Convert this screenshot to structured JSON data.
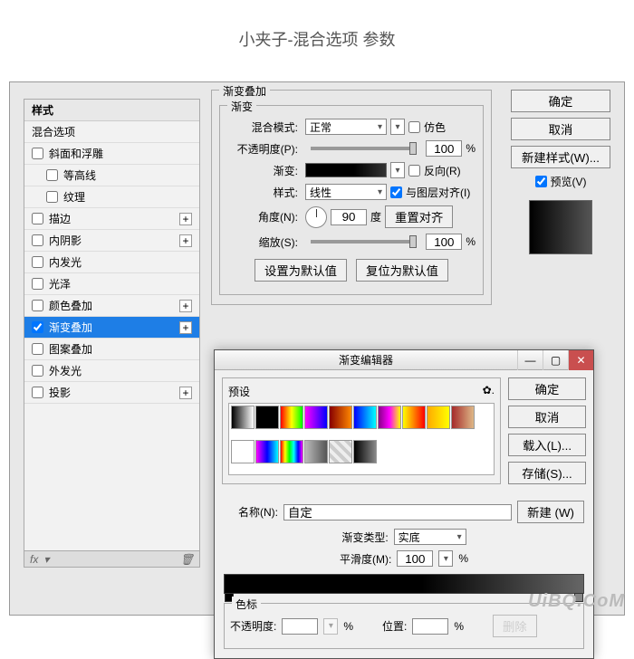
{
  "title": "小夹子-混合选项 参数",
  "styles": {
    "header": "样式",
    "sub": "混合选项",
    "items": [
      {
        "label": "斜面和浮雕",
        "checked": false,
        "plus": false
      },
      {
        "label": "等高线",
        "checked": false,
        "plus": false,
        "child": true
      },
      {
        "label": "纹理",
        "checked": false,
        "plus": false,
        "child": true
      },
      {
        "label": "描边",
        "checked": false,
        "plus": true
      },
      {
        "label": "内阴影",
        "checked": false,
        "plus": true
      },
      {
        "label": "内发光",
        "checked": false,
        "plus": false
      },
      {
        "label": "光泽",
        "checked": false,
        "plus": false
      },
      {
        "label": "颜色叠加",
        "checked": false,
        "plus": true
      },
      {
        "label": "渐变叠加",
        "checked": true,
        "plus": true,
        "selected": true
      },
      {
        "label": "图案叠加",
        "checked": false,
        "plus": false
      },
      {
        "label": "外发光",
        "checked": false,
        "plus": false
      },
      {
        "label": "投影",
        "checked": false,
        "plus": true
      }
    ],
    "fx": "fx"
  },
  "gradientOverlay": {
    "groupTitle": "渐变叠加",
    "innerTitle": "渐变",
    "blendModeLabel": "混合模式:",
    "blendModeValue": "正常",
    "ditherLabel": "仿色",
    "opacityLabel": "不透明度(P):",
    "opacityValue": "100",
    "percent": "%",
    "gradientLabel": "渐变:",
    "reverseLabel": "反向(R)",
    "styleLabel": "样式:",
    "styleValue": "线性",
    "alignLabel": "与图层对齐(I)",
    "angleLabel": "角度(N):",
    "angleValue": "90",
    "degree": "度",
    "resetAlign": "重置对齐",
    "scaleLabel": "缩放(S):",
    "scaleValue": "100",
    "defaultBtn": "设置为默认值",
    "resetBtn": "复位为默认值"
  },
  "rightButtons": {
    "ok": "确定",
    "cancel": "取消",
    "newStyle": "新建样式(W)...",
    "preview": "预览(V)"
  },
  "editor": {
    "title": "渐变编辑器",
    "presetsLabel": "预设",
    "gear": "✿.",
    "ok": "确定",
    "cancel": "取消",
    "load": "载入(L)...",
    "save": "存储(S)...",
    "nameLabel": "名称(N):",
    "nameValue": "自定",
    "newBtn": "新建 (W)",
    "gradTypeLabel": "渐变类型:",
    "gradTypeValue": "实底",
    "smoothLabel": "平滑度(M):",
    "smoothValue": "100",
    "percent": "%",
    "stopsTitle": "色标",
    "stopOpacityLabel": "不透明度:",
    "stopPosLabel": "位置:",
    "stopDelete": "删除"
  },
  "watermark": "UiBQ.CoM",
  "presetColors": [
    "linear-gradient(to right,#000,#fff)",
    "linear-gradient(to right,#000,#000)",
    "linear-gradient(to right,#f00,#ff0,#0f0)",
    "linear-gradient(to right,#f0f,#00f)",
    "linear-gradient(to right,#800,#f80)",
    "linear-gradient(to right,#00f,#0ff)",
    "linear-gradient(to right,#808,#f0f,#ff0)",
    "linear-gradient(to right,#ff0,#f00)",
    "linear-gradient(to right,#fa0,#ff0)",
    "linear-gradient(to right,#a52a2a,#deb887)",
    "linear-gradient(to right,#fff,#fff)",
    "linear-gradient(to right,#f0f,#00f,#0ff)",
    "linear-gradient(to right,#f00,#ff0,#0f0,#0ff,#00f,#f0f)",
    "linear-gradient(to right,#bbb,#555)",
    "repeating-linear-gradient(45deg,#eee 0 4px,#ccc 4px 8px)",
    "linear-gradient(to right,#000,#888)"
  ]
}
